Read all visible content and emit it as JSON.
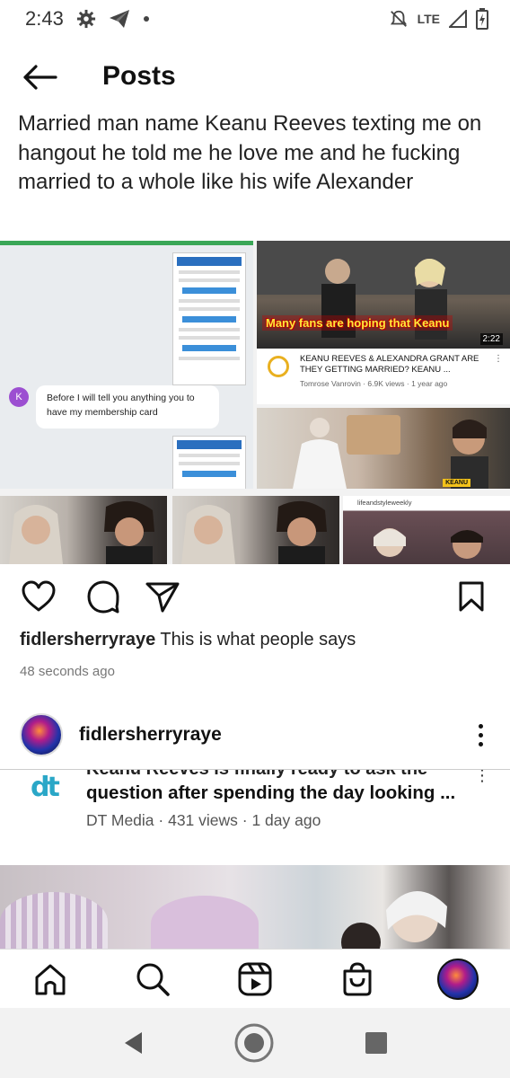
{
  "status_bar": {
    "time": "2:43",
    "network": "LTE",
    "icons": [
      "gear-icon",
      "telegram-icon",
      "dot-icon",
      "mute-icon",
      "signal-icon",
      "battery-icon"
    ]
  },
  "header": {
    "title": "Posts"
  },
  "post": {
    "text": "Married man name Keanu Reeves texting me on hangout he told me he love me and he fucking married to  a whole like his wife Alexander",
    "collage": {
      "chat_avatar_letter": "K",
      "chat_message": "Before I will tell you anything you to have my membership card",
      "video_caption": "Many fans are hoping that Keanu",
      "video_duration": "2:22",
      "video_title": "KEANU REEVES & ALEXANDRA GRANT ARE THEY GETTING MARRIED? KEANU ...",
      "video_meta": "Tomrose Vanrovin · 6.9K views · 1 year ago",
      "tag": "KEANU",
      "brand": "lifeandstyleweekly"
    },
    "username": "fidlersherryraye",
    "caption": "This is what people says",
    "timestamp": "48 seconds ago"
  },
  "post2": {
    "username": "fidlersherryraye",
    "news_cut_line": "Keanu Reeves is finally ready to ask the",
    "news_title": "question after spending the day looking ...",
    "news_meta": "DT Media · 431 views · 1 day ago",
    "source_logo": "dt"
  },
  "colors": {
    "accent_green": "#3aa757",
    "dt_blue": "#2aa7c7"
  }
}
